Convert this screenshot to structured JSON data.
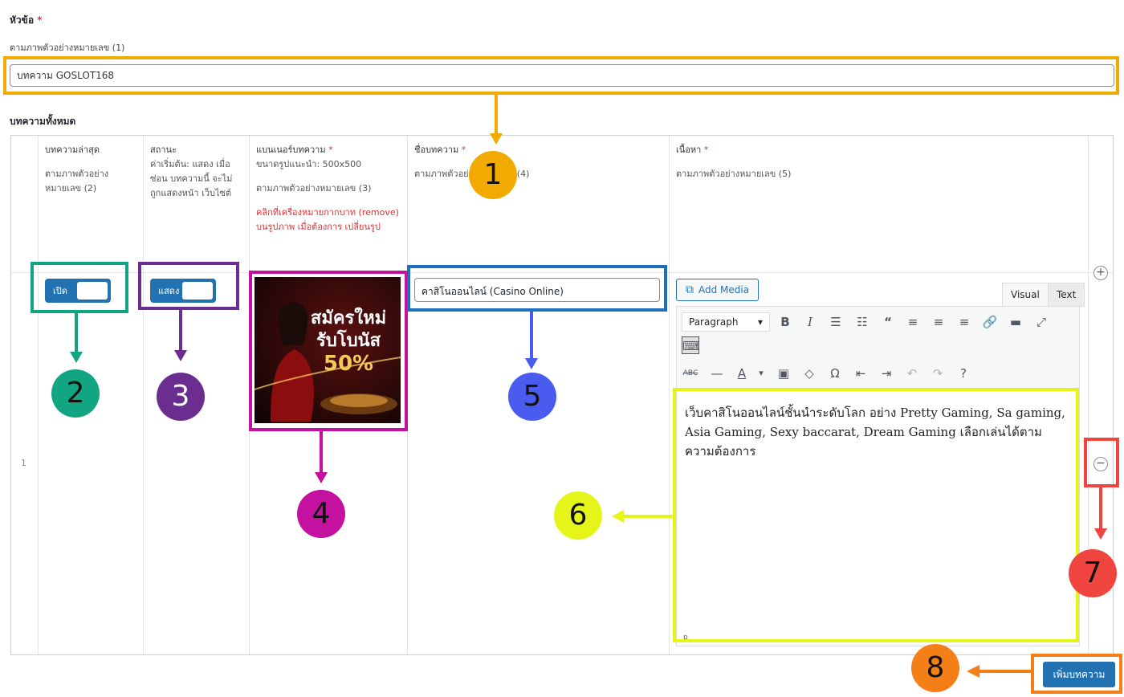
{
  "title_field": {
    "label": "หัวข้อ",
    "required_mark": "*",
    "description": "ตามภาพตัวอย่างหมายเลข (1)",
    "value": "บทความ GOSLOT168"
  },
  "section_label": "บทความทั้งหมด",
  "columns": {
    "latest": {
      "label": "บทความล่าสุด",
      "desc": "ตามภาพตัวอย่าง หมายเลข (2)"
    },
    "status": {
      "label": "สถานะ",
      "desc": "ค่าเริ่มต้น: แสดง เมื่อซ่อน บทความนี้ จะไม่ถูกแสดงหน้า เว็บไซต์"
    },
    "banner": {
      "label": "แบนเนอร์บทความ",
      "req": "*",
      "size": "ขนาดรูปแนะนำ: 500x500",
      "desc": "ตามภาพตัวอย่างหมายเลข (3)",
      "note": "คลิกที่เครื่องหมายกากบาท (remove) บนรูปภาพ เมื่อต้องการ เปลี่ยนรูป"
    },
    "category": {
      "label": "ชื่อบทความ",
      "req": "*",
      "desc": "ตามภาพตัวอย่างหมายเลข (4)"
    },
    "content": {
      "label": "เนื้อหา",
      "req": "*",
      "desc": "ตามภาพตัวอย่างหมายเลข (5)"
    }
  },
  "row": {
    "index": "1",
    "latest_toggle": "เปิด",
    "status_toggle": "แสดง",
    "banner_text_line1": "สมัครใหม่",
    "banner_text_line2": "รับโบนัส",
    "banner_text_line3": "50%",
    "category_value": "คาสิโนออนไลน์ (Casino Online)",
    "add_media": "Add Media",
    "tab_visual": "Visual",
    "tab_text": "Text",
    "format_select": "Paragraph",
    "editor_text": "เว็บคาสิโนออนไลน์ชั้นนำระดับโลก อย่าง Pretty Gaming, Sa gaming, Asia Gaming, Sexy baccarat, Dream Gaming เลือกเล่นได้ตามความต้องการ",
    "editor_path": "p"
  },
  "add_row_symbol": "+",
  "remove_row_symbol": "−",
  "submit_label": "เพิ่มบทความ",
  "annotations": [
    "1",
    "2",
    "3",
    "4",
    "5",
    "6",
    "7",
    "8"
  ],
  "colors": {
    "orange_annot": "#f2a900",
    "teal_annot": "#12a581",
    "purple_annot": "#6b2d8f",
    "magenta_annot": "#c4119f",
    "blue_annot": "#1f6fbf",
    "indigo_annot": "#4a5cf0",
    "yellow_annot": "#e6f519",
    "red_annot": "#f0443f",
    "dark_orange_annot": "#f57f17",
    "wp_blue": "#2271b1"
  }
}
